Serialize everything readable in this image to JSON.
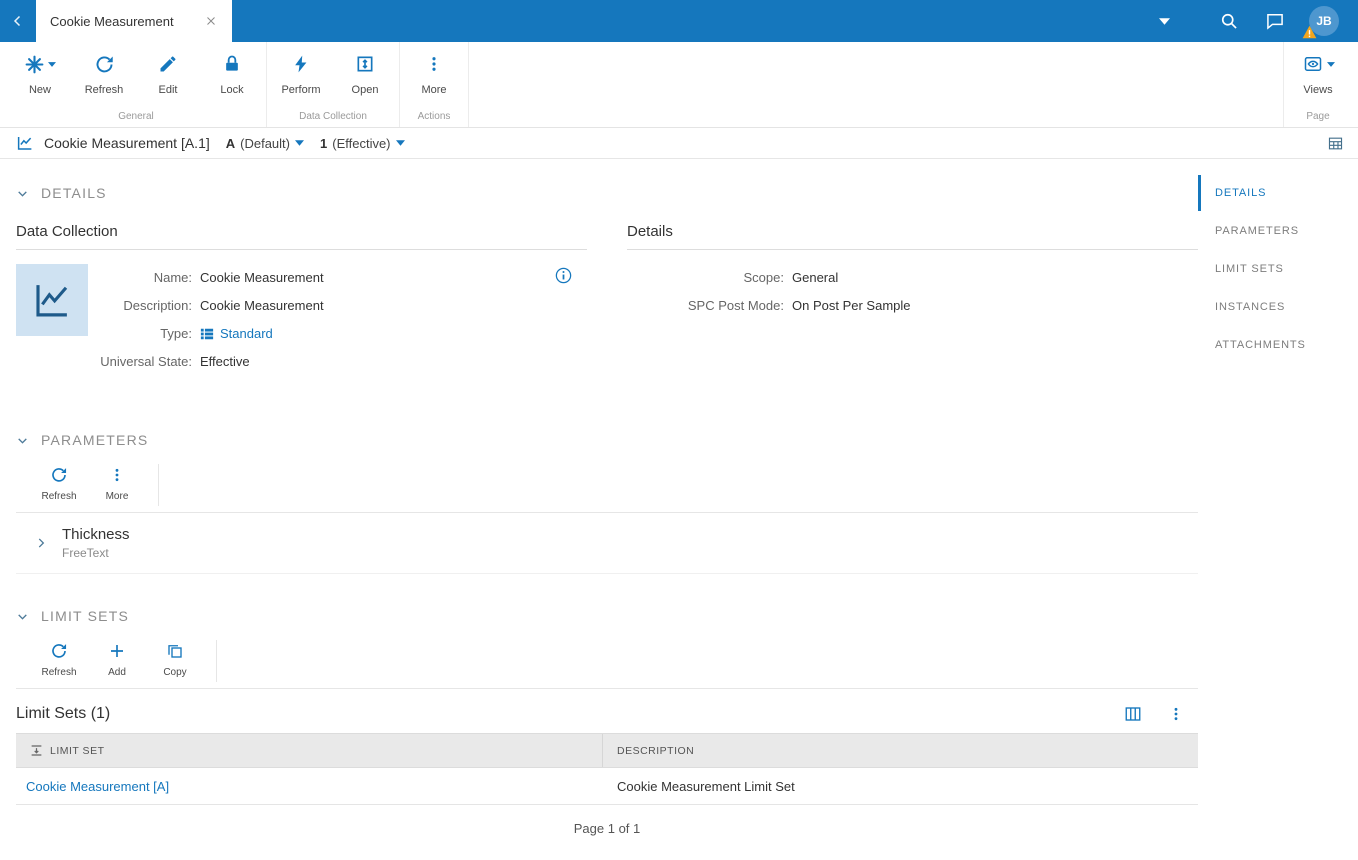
{
  "colors": {
    "primary": "#1577bd",
    "warning": "#f2a51d",
    "tile_bg": "#cfe2f2",
    "table_header_bg": "#e9e9e9",
    "link": "#1577bd"
  },
  "topbar": {
    "tab_title": "Cookie Measurement",
    "avatar": "JB"
  },
  "ribbon": {
    "buttons": {
      "new": "New",
      "refresh": "Refresh",
      "edit": "Edit",
      "lock": "Lock",
      "perform": "Perform",
      "open": "Open",
      "more": "More",
      "views": "Views"
    },
    "groups": {
      "general": "General",
      "data_collection": "Data Collection",
      "actions": "Actions",
      "page": "Page"
    }
  },
  "entity": {
    "title": "Cookie Measurement [A.1]",
    "version": "A",
    "version_suffix": "(Default)",
    "revision": "1",
    "revision_suffix": "(Effective)"
  },
  "nav": {
    "items": [
      "DETAILS",
      "PARAMETERS",
      "LIMIT SETS",
      "INSTANCES",
      "ATTACHMENTS"
    ],
    "active_index": 0
  },
  "details": {
    "header": "DETAILS",
    "data_collection": {
      "title": "Data Collection",
      "fields": [
        {
          "label": "Name:",
          "value": "Cookie Measurement"
        },
        {
          "label": "Description:",
          "value": "Cookie Measurement"
        },
        {
          "label": "Type:",
          "value": "Standard"
        },
        {
          "label": "Universal State:",
          "value": "Effective"
        }
      ]
    },
    "details_panel": {
      "title": "Details",
      "fields": [
        {
          "label": "Scope:",
          "value": "General"
        },
        {
          "label": "SPC Post Mode:",
          "value": "On Post Per Sample"
        }
      ]
    }
  },
  "parameters": {
    "header": "PARAMETERS",
    "toolbar": {
      "refresh": "Refresh",
      "more": "More"
    },
    "items": [
      {
        "name": "Thickness",
        "type": "FreeText"
      }
    ]
  },
  "limit_sets": {
    "header": "LIMIT SETS",
    "toolbar": {
      "refresh": "Refresh",
      "add": "Add",
      "copy": "Copy"
    },
    "list_title": "Limit Sets (1)",
    "columns": {
      "limit_set": "LIMIT SET",
      "description": "DESCRIPTION"
    },
    "rows": [
      {
        "limit_set": "Cookie Measurement [A]",
        "description": "Cookie Measurement Limit Set"
      }
    ]
  },
  "pagination": {
    "label": "Page 1 of 1"
  }
}
